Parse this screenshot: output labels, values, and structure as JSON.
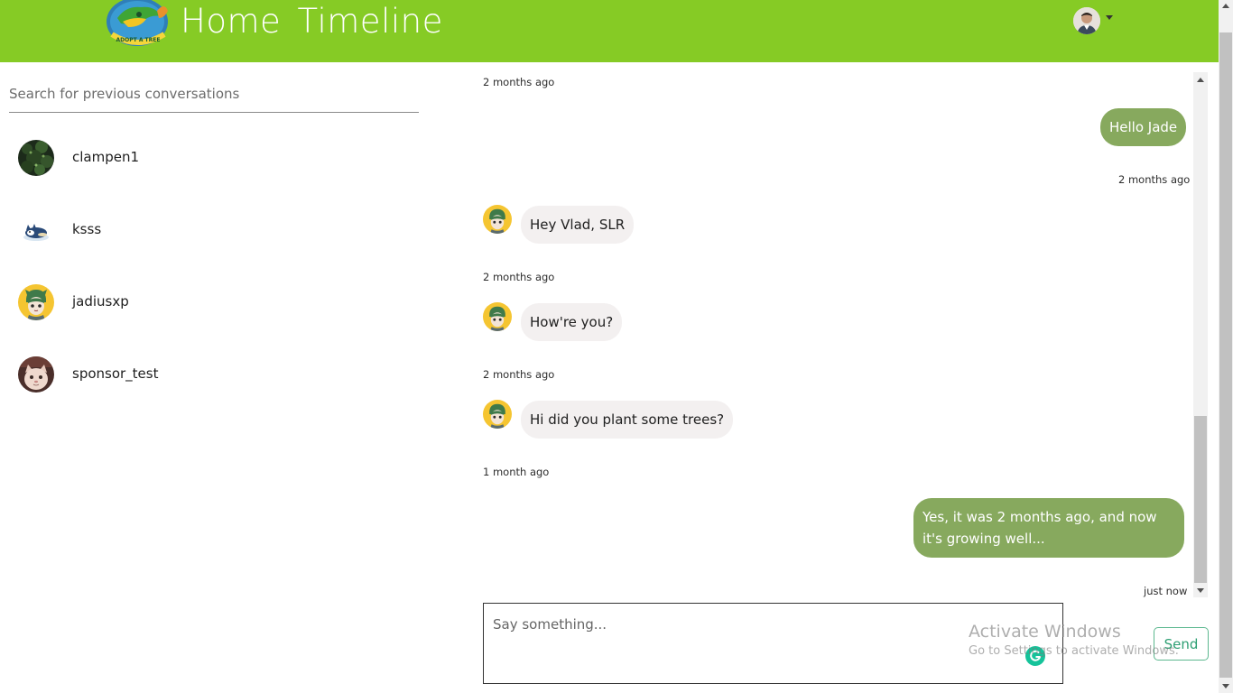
{
  "header": {
    "title": "Home  Timeline",
    "logo_text": "ADOPT A TREE",
    "brand_color": "#86cb25"
  },
  "sidebar": {
    "search_placeholder": "Search for previous conversations",
    "contacts": [
      {
        "name": "clampen1",
        "avatar": "tree-photo-avatar"
      },
      {
        "name": "ksss",
        "avatar": "cat-illustration-avatar"
      },
      {
        "name": "jadiusxp",
        "avatar": "anime-character-avatar"
      },
      {
        "name": "sponsor_test",
        "avatar": "cat-photo-avatar"
      }
    ]
  },
  "chat": {
    "messages": [
      {
        "time": "2 months ago",
        "text": "Hello Jade",
        "direction": "outgoing"
      },
      {
        "time": "2 months ago",
        "text": "Hey Vlad, SLR",
        "direction": "incoming"
      },
      {
        "time": "2 months ago",
        "text": "How're you?",
        "direction": "incoming"
      },
      {
        "time": "2 months ago",
        "text": "Hi did you plant some trees?",
        "direction": "incoming"
      },
      {
        "time": "1 month ago",
        "text": "Yes, it was 2 months ago, and now it's growing well...",
        "direction": "outgoing"
      }
    ],
    "last_time": "just now",
    "outgoing_color": "#87a95e",
    "incoming_color": "#f3f0f0"
  },
  "compose": {
    "placeholder": "Say something...",
    "send_label": "Send"
  },
  "watermark": {
    "title": "Activate Windows",
    "subtitle": "Go to Settings to activate Windows."
  }
}
